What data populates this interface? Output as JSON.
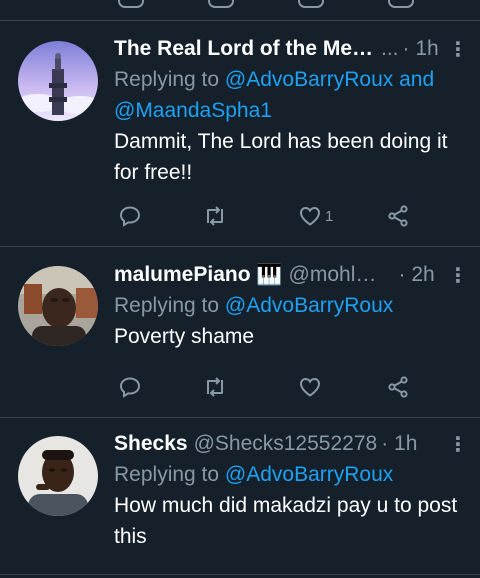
{
  "colors": {
    "background": "#15202b",
    "divider": "#38444d",
    "muted": "#8899a6",
    "link": "#1da1f2"
  },
  "tweets": [
    {
      "name": "The Real Lord of the Media",
      "handle": "",
      "time": "1h",
      "replying_prefix": "Replying to",
      "replying_to": "@AdvoBarryRoux and @MaandaSpha1",
      "text": "Dammit, The Lord has been doing it for free!!",
      "like_count": "1"
    },
    {
      "name": "malumePiano 🎹",
      "handle": "@mohlephi...",
      "time": "2h",
      "replying_prefix": "Replying to",
      "replying_to": "@AdvoBarryRoux",
      "text": "Poverty shame",
      "like_count": ""
    },
    {
      "name": "Shecks",
      "handle": "@Shecks12552278",
      "time": "1h",
      "replying_prefix": "Replying to",
      "replying_to": "@AdvoBarryRoux",
      "text": "How much did makadzi pay u to post this",
      "like_count": ""
    }
  ]
}
